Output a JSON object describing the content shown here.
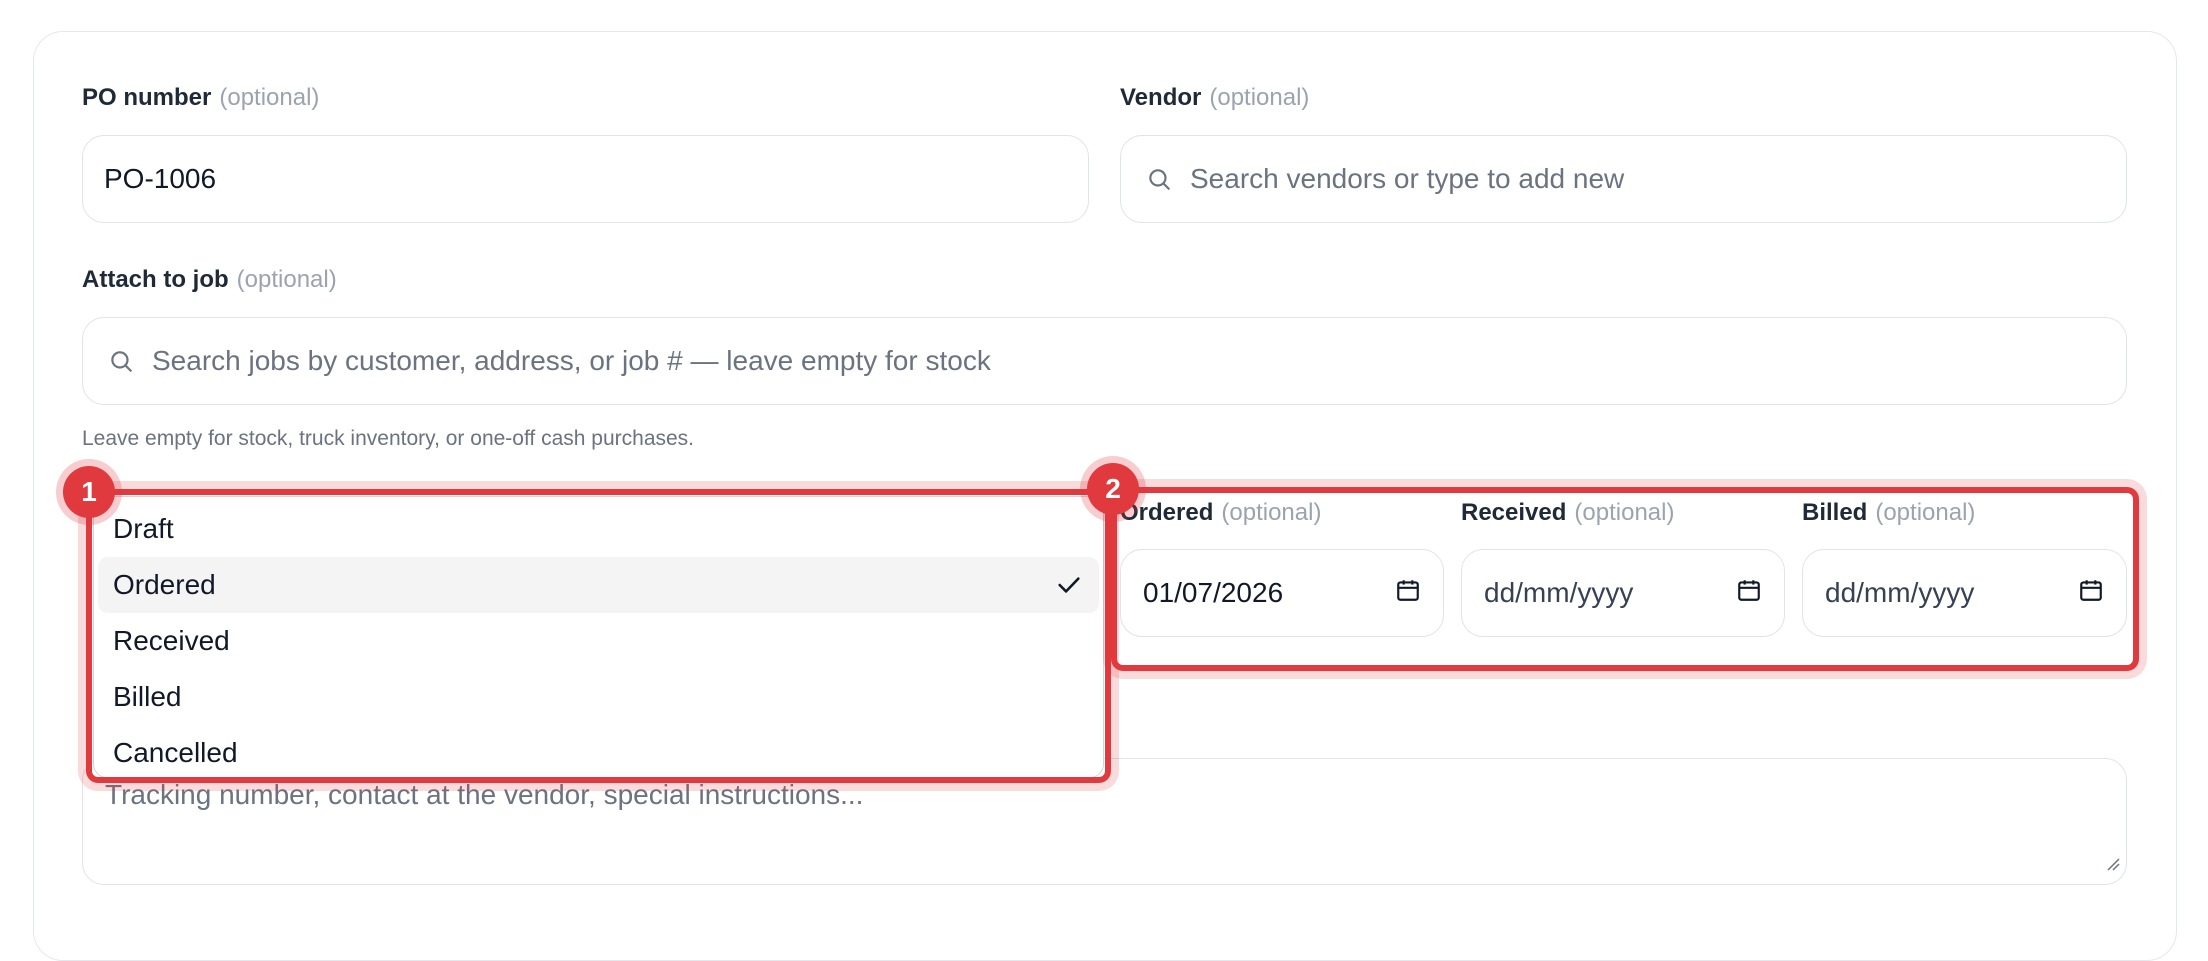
{
  "po_number": {
    "label": "PO number",
    "optional": "(optional)",
    "value": "PO-1006"
  },
  "vendor": {
    "label": "Vendor",
    "optional": "(optional)",
    "placeholder": "Search vendors or type to add new"
  },
  "job": {
    "label": "Attach to job",
    "optional": "(optional)",
    "placeholder": "Search jobs by customer, address, or job # — leave empty for stock",
    "help": "Leave empty for stock, truck inventory, or one-off cash purchases."
  },
  "status_dropdown": {
    "options": [
      "Draft",
      "Ordered",
      "Received",
      "Billed",
      "Cancelled"
    ],
    "selected": "Ordered"
  },
  "dates": {
    "ordered": {
      "label": "Ordered",
      "optional": "(optional)",
      "value": "01/07/2026"
    },
    "received": {
      "label": "Received",
      "optional": "(optional)",
      "value": "dd/mm/yyyy"
    },
    "billed": {
      "label": "Billed",
      "optional": "(optional)",
      "value": "dd/mm/yyyy"
    }
  },
  "notes": {
    "placeholder": "Tracking number, contact at the vendor, special instructions..."
  },
  "annotations": {
    "badge_1": "1",
    "badge_2": "2"
  },
  "colors": {
    "highlight": "#e0393e",
    "border": "#e0e3e8",
    "muted": "#9ca3af"
  },
  "icons": {
    "search": "search-icon",
    "calendar": "calendar-icon",
    "check": "check-icon"
  }
}
